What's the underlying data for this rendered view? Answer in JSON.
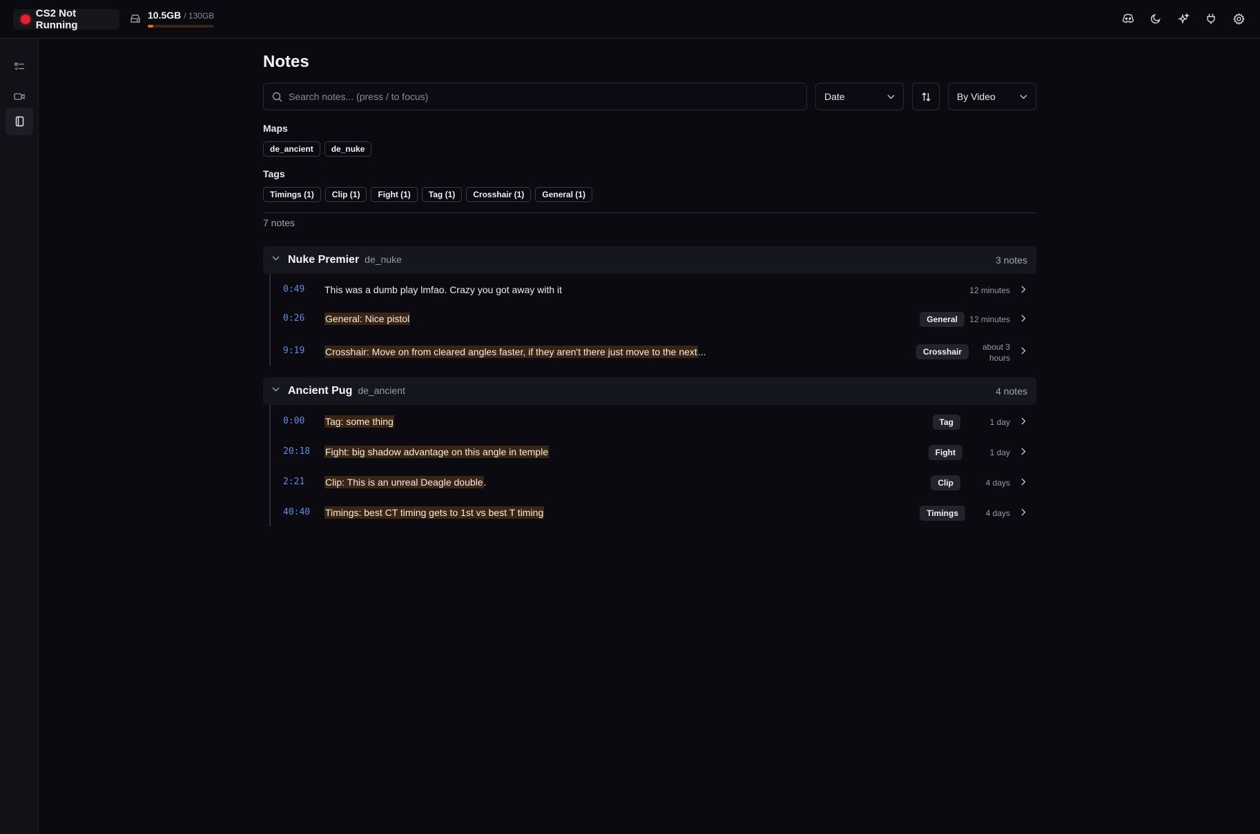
{
  "topbar": {
    "status": "CS2 Not Running",
    "disk_used": "10.5GB",
    "disk_total": "/ 130GB",
    "disk_fraction": 0.08,
    "icons": [
      "discord-icon",
      "moon-icon",
      "sparkles-icon",
      "plug-icon",
      "gear-icon"
    ]
  },
  "sidebar": {
    "items": [
      "list-icon",
      "video-icon",
      "notebook-icon"
    ],
    "active": "notebook-icon"
  },
  "colors": {
    "accent": "#5b8fe0",
    "status_red": "#e5222b",
    "disk_orange": "#f06a1b",
    "highlight": "#3a2414"
  },
  "page": {
    "title": "Notes",
    "search_placeholder": "Search notes... (press / to focus)",
    "sort_select": "Date",
    "group_select": "By Video",
    "maps_label": "Maps",
    "maps": [
      "de_ancient",
      "de_nuke"
    ],
    "tags_label": "Tags",
    "tags": [
      "Timings (1)",
      "Clip (1)",
      "Fight (1)",
      "Tag (1)",
      "Crosshair (1)",
      "General (1)"
    ],
    "count": "7 notes"
  },
  "groups": [
    {
      "title": "Nuke Premier",
      "map": "de_nuke",
      "count": "3 notes",
      "notes": [
        {
          "ts": "0:49",
          "text": "This was a dumb play lmfao. Crazy you got away with it",
          "tag": "",
          "time": "12 minutes"
        },
        {
          "ts": "0:26",
          "text": "General: Nice pistol",
          "tag": "General",
          "time": "12 minutes"
        },
        {
          "ts": "9:19",
          "text": "Crosshair: Move on from cleared angles faster, if they aren't there just move to the next",
          "ellipsis": "...",
          "tag": "Crosshair",
          "time_line1": "about 3",
          "time_line2": "hours"
        }
      ]
    },
    {
      "title": "Ancient Pug",
      "map": "de_ancient",
      "count": "4 notes",
      "notes": [
        {
          "ts": "0:00",
          "text": "Tag: some thing",
          "tag": "Tag",
          "time": "1 day"
        },
        {
          "ts": "20:18",
          "text": "Fight: big shadow advantage on this angle in temple",
          "tag": "Fight",
          "time": "1 day"
        },
        {
          "ts": "2:21",
          "text": "Clip: This is an unreal Deagle double",
          "suffix": ".",
          "tag": "Clip",
          "time": "4 days"
        },
        {
          "ts": "40:40",
          "text": "Timings: best CT timing gets to 1st vs best T timing",
          "tag": "Timings",
          "time": "4 days"
        }
      ]
    }
  ]
}
